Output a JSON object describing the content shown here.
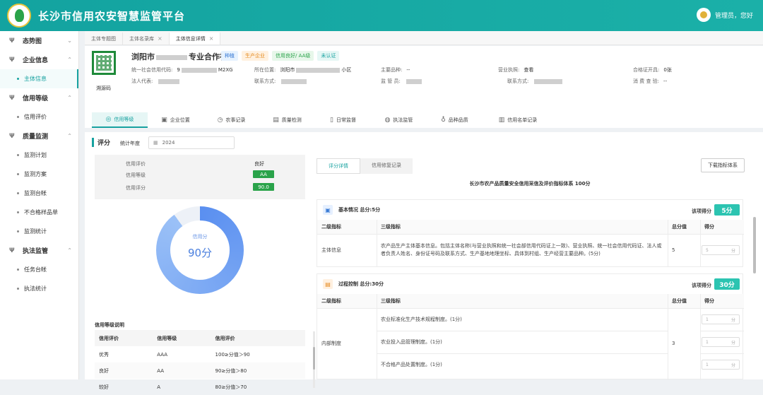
{
  "header": {
    "title": "长沙市信用农安智慧监管平台",
    "user": "管理员，您好"
  },
  "sidebar": {
    "groups": [
      {
        "label": "态势图",
        "items": []
      },
      {
        "label": "企业信息",
        "items": [
          "主体信息"
        ]
      },
      {
        "label": "信用等级",
        "items": [
          "信用评价"
        ]
      },
      {
        "label": "质量监测",
        "items": [
          "监测计划",
          "监测方案",
          "监测台帐",
          "不合格样品单",
          "监测统计"
        ]
      },
      {
        "label": "执法监管",
        "items": [
          "任务台帐",
          "执法统计"
        ]
      }
    ],
    "active": "主体信息"
  },
  "tabs": [
    {
      "label": "主体专题图",
      "close": false
    },
    {
      "label": "主体名录库",
      "close": true
    },
    {
      "label": "主体信息详情",
      "close": true
    }
  ],
  "entity": {
    "qr_label": "溯源码",
    "name_prefix": "浏阳市",
    "name_suffix": "专业合作社",
    "tags": [
      "种植",
      "生产企业",
      "信用良好/ AA级",
      "未认证"
    ],
    "credit_code_label": "统一社会信用代码:",
    "credit_code_prefix": "9",
    "credit_code_suffix": "M2XG",
    "legal_label": "法人代表:",
    "location_label": "所在位置:",
    "location_prefix": "浏阳市",
    "location_suffix": "小区",
    "contact_label": "联系方式:",
    "product_label": "主要品种:",
    "product_value": "--",
    "supervisor_label": "监 管 员:",
    "license_label": "营业执照:",
    "license_value": "查看",
    "contact2_label": "联系方式:",
    "cert_label": "合格证开具:",
    "cert_value": "0张",
    "consume_label": "消 费 查 验:",
    "consume_value": "--"
  },
  "nav_tabs": [
    "信用等级",
    "企业位置",
    "农事记录",
    "质量检测",
    "日常监督",
    "执法监管",
    "品种品质",
    "信用名单记录"
  ],
  "score": {
    "section_title": "评分",
    "year_label": "统计年度",
    "year": "2024",
    "credit_eval_label": "信用评价",
    "credit_eval": "良好",
    "credit_level_label": "信用等级",
    "credit_level": "AA",
    "credit_score_label": "信用评分",
    "credit_score": "90.0",
    "donut_label": "信用分",
    "donut_value": "90分",
    "donut_fraction": 0.9
  },
  "level_legend": {
    "title": "信用等级说明",
    "columns": [
      "信用评价",
      "信用等级",
      "信用评价"
    ],
    "rows": [
      [
        "优秀",
        "AAA",
        "100≥分值＞90"
      ],
      [
        "良好",
        "AA",
        "90≥分值＞80"
      ],
      [
        "较好",
        "A",
        "80≥分值＞70"
      ]
    ]
  },
  "detail": {
    "subtabs": [
      "评分详情",
      "信用修复记录"
    ],
    "download": "下载指标体系",
    "title": "长沙市农产品质量安全信用采信及评价指标体系 100分",
    "item_score_label": "该项得分",
    "cols": [
      "二级指标",
      "三级指标",
      "总分值",
      "得分"
    ],
    "cards": [
      {
        "title": "基本情况 总分:5分",
        "score": "5分",
        "rows": [
          {
            "l2": "主体信息",
            "l3": "农产品生产主体基本信息。包括主体名称(与营业执照和统一社会部信用代码证上一致)、营业执照、统一社会信用代码证、法人或者负责人姓名、身份证号码及联系方式、生产基地地理坐标、具体到村组、生产经营主要品种。(5分)",
            "total": "5",
            "got": "5",
            "unit": "分"
          }
        ]
      },
      {
        "title": "过程控制 总分:30分",
        "score": "30分",
        "l2": "内部制度",
        "total": "3",
        "rows": [
          {
            "l3": "农业标准化生产技术规程制度。(1分)",
            "got": "1",
            "unit": "分"
          },
          {
            "l3": "农业投入品管理制度。(1分)",
            "got": "1",
            "unit": "分"
          },
          {
            "l3": "不合格产品处置制度。(1分)",
            "got": "1",
            "unit": "分"
          }
        ]
      }
    ]
  }
}
